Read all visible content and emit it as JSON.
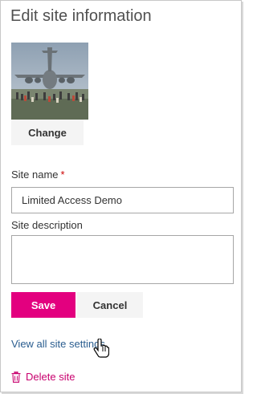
{
  "panel": {
    "title": "Edit site information",
    "change_label": "Change",
    "site_name_label": "Site name",
    "required_marker": "*",
    "site_name_value": "Limited Access Demo",
    "site_description_label": "Site description",
    "site_description_value": "",
    "save_label": "Save",
    "cancel_label": "Cancel",
    "view_all_label": "View all site settings",
    "delete_label": "Delete site"
  },
  "colors": {
    "accent": "#e3007f",
    "link": "#2a5d8f",
    "delete": "#c8006e"
  },
  "icons": {
    "site_logo": "cargo-plane-photo",
    "pointer": "hand-pointer-icon",
    "delete": "trash-icon"
  }
}
